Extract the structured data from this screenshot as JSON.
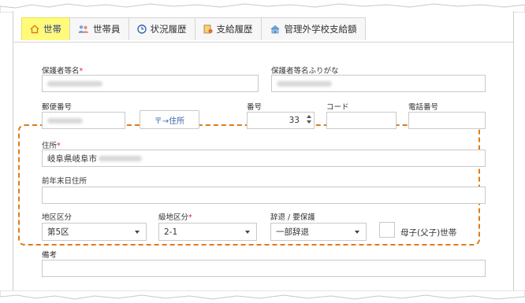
{
  "tabs": [
    {
      "label": "世帯",
      "icon": "home-icon",
      "active": true
    },
    {
      "label": "世帯員",
      "icon": "people-icon",
      "active": false
    },
    {
      "label": "状況履歴",
      "icon": "clock-icon",
      "active": false
    },
    {
      "label": "支給履歴",
      "icon": "ledger-icon",
      "active": false
    },
    {
      "label": "管理外学校支給額",
      "icon": "school-icon",
      "active": false
    }
  ],
  "form": {
    "guardian_name": {
      "label": "保護者等名",
      "required_mark": "*"
    },
    "guardian_kana": {
      "label": "保護者等名ふりがな"
    },
    "postal_code": {
      "label": "郵便番号"
    },
    "postal_button": {
      "label": "〒→住所"
    },
    "number": {
      "label": "番号",
      "value": "33"
    },
    "code": {
      "label": "コード"
    },
    "phone": {
      "label": "電話番号"
    },
    "address": {
      "label": "住所",
      "required_mark": "*",
      "value": "岐阜県岐阜市"
    },
    "prev_year_address": {
      "label": "前年末日住所"
    },
    "district": {
      "label": "地区区分",
      "value": "第5区"
    },
    "grade_district": {
      "label": "級地区分",
      "required_mark": "*",
      "value": "2-1"
    },
    "withdrawal": {
      "label": "辞退 / 要保護",
      "value": "一部辞退"
    },
    "single_parent": {
      "label": "母子(父子)世帯"
    },
    "remarks": {
      "label": "備考"
    }
  },
  "colors": {
    "highlight_tab": "#fffa7a",
    "annotation_border": "#e07a1a",
    "required": "#d23333"
  }
}
